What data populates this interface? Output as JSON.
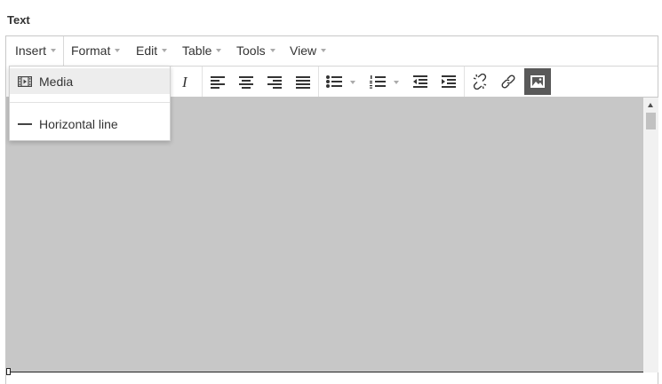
{
  "field": {
    "label": "Text"
  },
  "menubar": {
    "items": [
      {
        "label": "Insert",
        "active": true
      },
      {
        "label": "Format"
      },
      {
        "label": "Edit"
      },
      {
        "label": "Table"
      },
      {
        "label": "Tools"
      },
      {
        "label": "View"
      }
    ]
  },
  "insert_menu": {
    "items": [
      {
        "label": "Media",
        "icon": "media-icon",
        "highlighted": true
      },
      {
        "label": "Horizontal line",
        "icon": "horizontal-line-icon"
      }
    ]
  },
  "toolbar": {
    "icons": [
      "italic-icon",
      "align-left-icon",
      "align-center-icon",
      "align-right-icon",
      "align-justify-icon",
      "bullet-list-icon",
      "numbered-list-icon",
      "outdent-icon",
      "indent-icon",
      "unlink-icon",
      "link-icon",
      "image-icon"
    ],
    "pressed": "image-icon"
  },
  "colors": {
    "content_background": "#c7c7c7",
    "pressed_button": "#595959",
    "text": "#333333",
    "border": "#c8c8c8"
  }
}
